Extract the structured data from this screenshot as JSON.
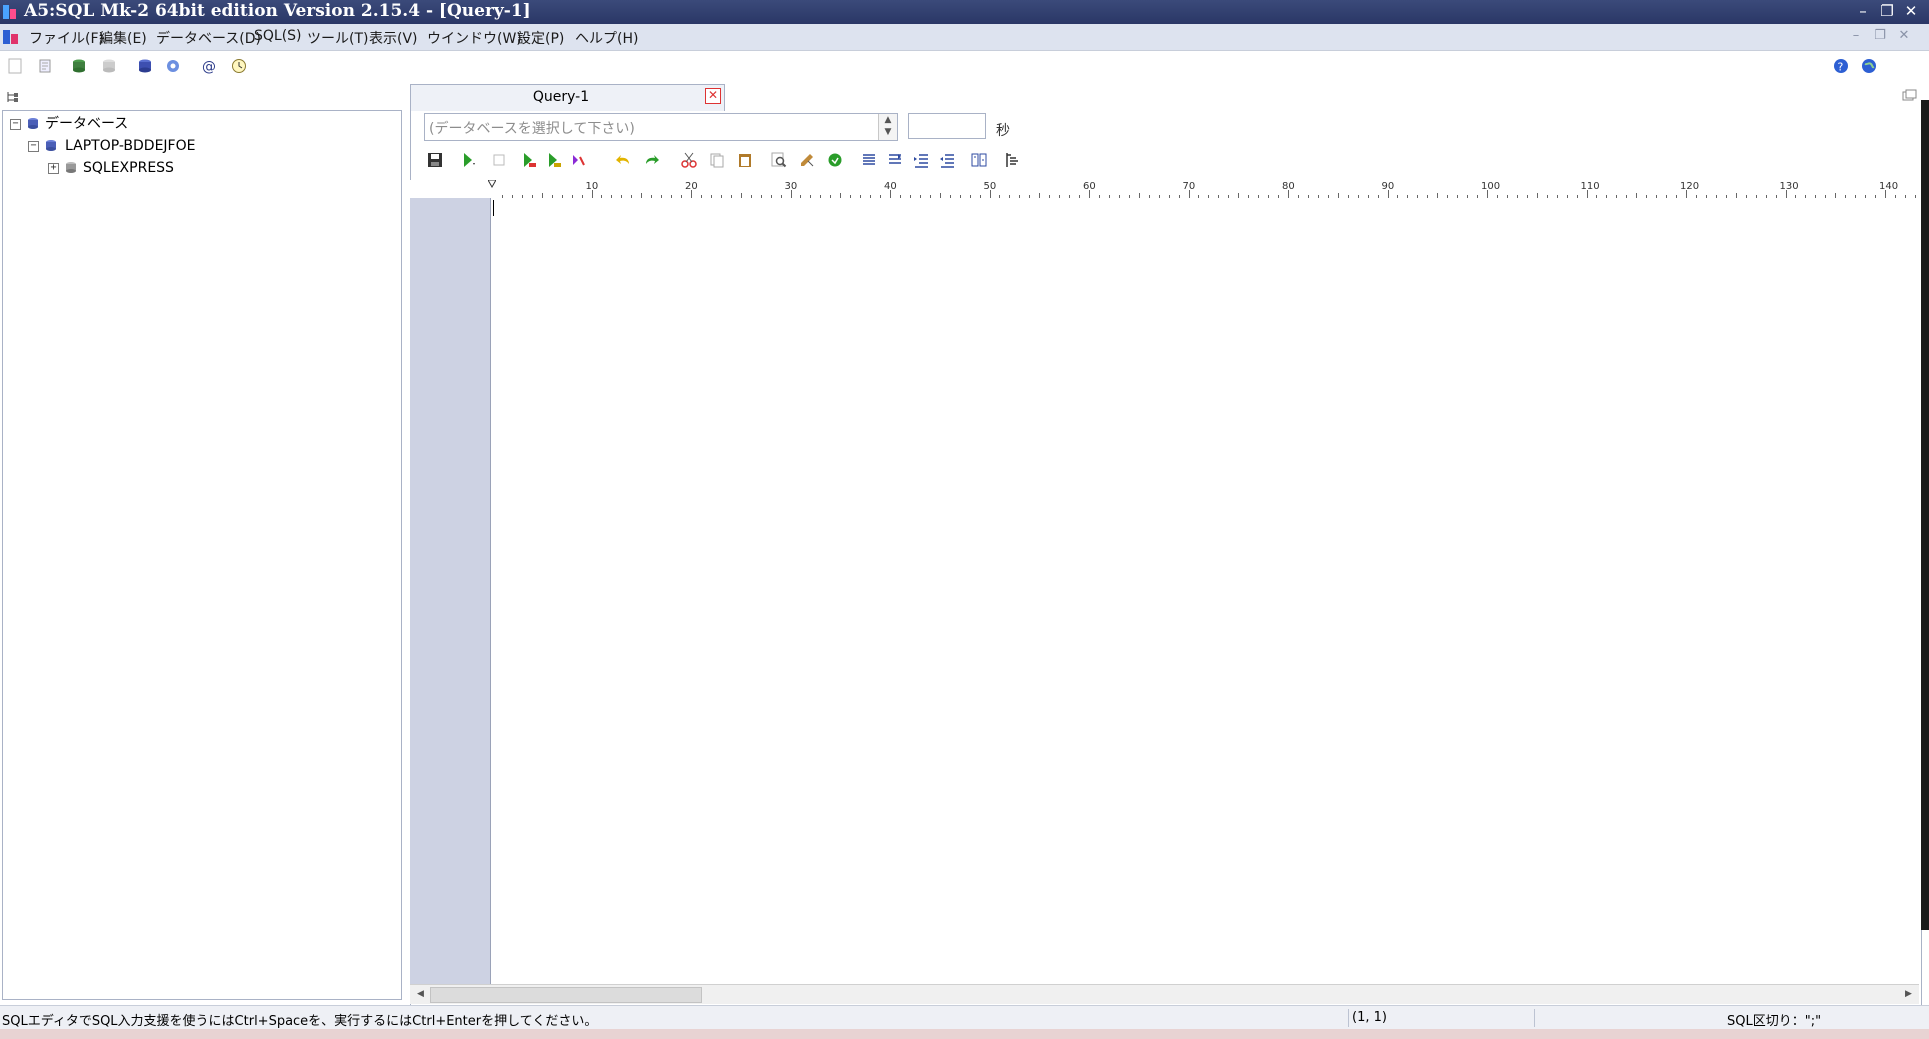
{
  "window": {
    "title": "A5:SQL Mk-2 64bit edition Version 2.15.4 - [Query-1]",
    "controls": {
      "minimize": "–",
      "restore": "❐",
      "close": "✕"
    }
  },
  "menubar": {
    "items": [
      "ファイル(F)",
      "編集(E)",
      "データベース(D)",
      "SQL(S)",
      "ツール(T)",
      "表示(V)",
      "ウインドウ(W)",
      "設定(P)",
      "ヘルプ(H)"
    ],
    "mdi_controls": {
      "minimize": "–",
      "restore": "❐",
      "close": "✕"
    }
  },
  "toolbar": {
    "icons": [
      "new-icon",
      "open-icon",
      "connect-database-icon",
      "disconnect-database-icon",
      "database-icon",
      "settings-icon",
      "at-icon",
      "clock-icon"
    ],
    "right_icons": [
      "help-icon",
      "web-icon"
    ]
  },
  "tree": {
    "nodes": [
      {
        "label": "データベース",
        "expander": "−",
        "icon": "databases-icon"
      },
      {
        "label": "LAPTOP-BDDEJFOE",
        "expander": "−",
        "icon": "server-icon"
      },
      {
        "label": "SQLEXPRESS",
        "expander": "+",
        "icon": "sqlserver-icon"
      }
    ]
  },
  "editor": {
    "tab_label": "Query-1",
    "tab_close": "✕",
    "db_select_placeholder": "(データベースを選択して下さい)",
    "timeout_value": "",
    "timeout_unit": "秒",
    "toolbar_icons": [
      "save-icon",
      "run-icon",
      "stop-icon",
      "run-step-icon",
      "run-csv-icon",
      "explain-icon",
      "undo-icon",
      "redo-icon",
      "cut-icon",
      "copy-icon",
      "paste-icon",
      "find-icon",
      "replace-icon",
      "format-icon",
      "align-left-icon",
      "align-wrap-icon",
      "indent-icon",
      "outdent-icon",
      "compare-icon",
      "outline-icon"
    ],
    "ruler_labels": [
      "10",
      "20",
      "30",
      "40",
      "50",
      "60",
      "70",
      "80",
      "90",
      "100",
      "110",
      "120",
      "130",
      "140"
    ]
  },
  "statusbar": {
    "message": "SQLエディタでSQL入力支援を使うにはCtrl+Spaceを、実行するにはCtrl+Enterを押してください。",
    "position": "(1, 1)",
    "delimiter": "SQL区切り：\";\""
  },
  "colors": {
    "titlebar": "#2a3766",
    "menubar": "#dde3ef",
    "gutter": "#cdd2e3",
    "accent_green": "#2a9d2a"
  }
}
